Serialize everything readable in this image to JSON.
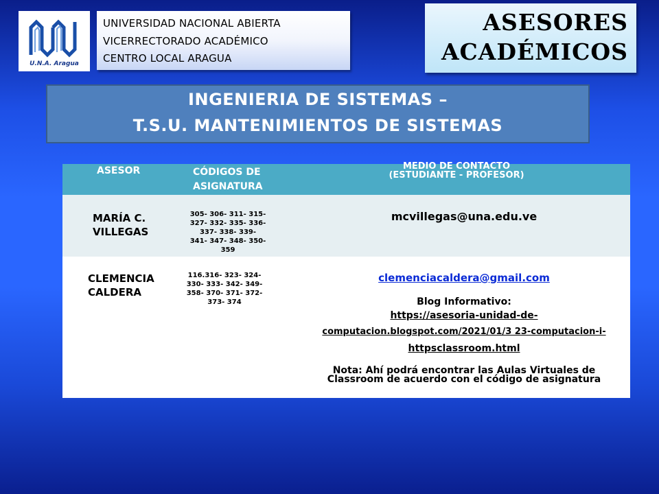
{
  "header": {
    "logo_caption": "U.N.A. Aragua",
    "university_lines": [
      "UNIVERSIDAD NACIONAL ABIERTA",
      "VICERRECTORADO  ACADÉMICO",
      "CENTRO LOCAL ARAGUA"
    ],
    "advisors_title": [
      "ASESORES",
      "ACADÉMICOS"
    ]
  },
  "banner": {
    "line1": "INGENIERIA DE SISTEMAS –",
    "line2": "T.S.U. MANTENIMIENTOS DE SISTEMAS"
  },
  "table": {
    "headers": {
      "advisor": "ASESOR",
      "codes": [
        "CÓDIGOS DE",
        "ASIGNATURA"
      ],
      "contact": [
        "MEDIO DE CONTACTO",
        "(ESTUDIANTE - PROFESOR)"
      ]
    },
    "rows": [
      {
        "name": [
          "MARÍA C.",
          "VILLEGAS"
        ],
        "codes": [
          "305- 306- 311- 315-",
          "327- 332- 335- 336-",
          "337- 338- 339-",
          "341- 347- 348- 350-",
          "359"
        ],
        "email": "mcvillegas@una.edu.ve"
      },
      {
        "name": [
          "CLEMENCIA",
          "CALDERA"
        ],
        "codes": [
          "116.316- 323- 324-",
          "330- 333- 342- 349-",
          "358- 370- 371- 372-",
          "373- 374"
        ],
        "email": "clemenciacaldera@gmail.com",
        "blog_label": "Blog Informativo:",
        "blog_url_lines": [
          "https://asesoria-unidad-de-",
          "computacion.blogspot.com/2021/01/3 23-computacion-i-",
          "httpsclassroom.html"
        ],
        "note_lines": [
          "Nota: Ahí podrá encontrar las Aulas Virtuales de",
          "Classroom de acuerdo con el código de asignatura"
        ]
      }
    ]
  },
  "colors": {
    "background": "#2a66ff",
    "banner": "#4f80bd",
    "table_header": "#4babc6",
    "row_alt": "#e6eff2"
  }
}
